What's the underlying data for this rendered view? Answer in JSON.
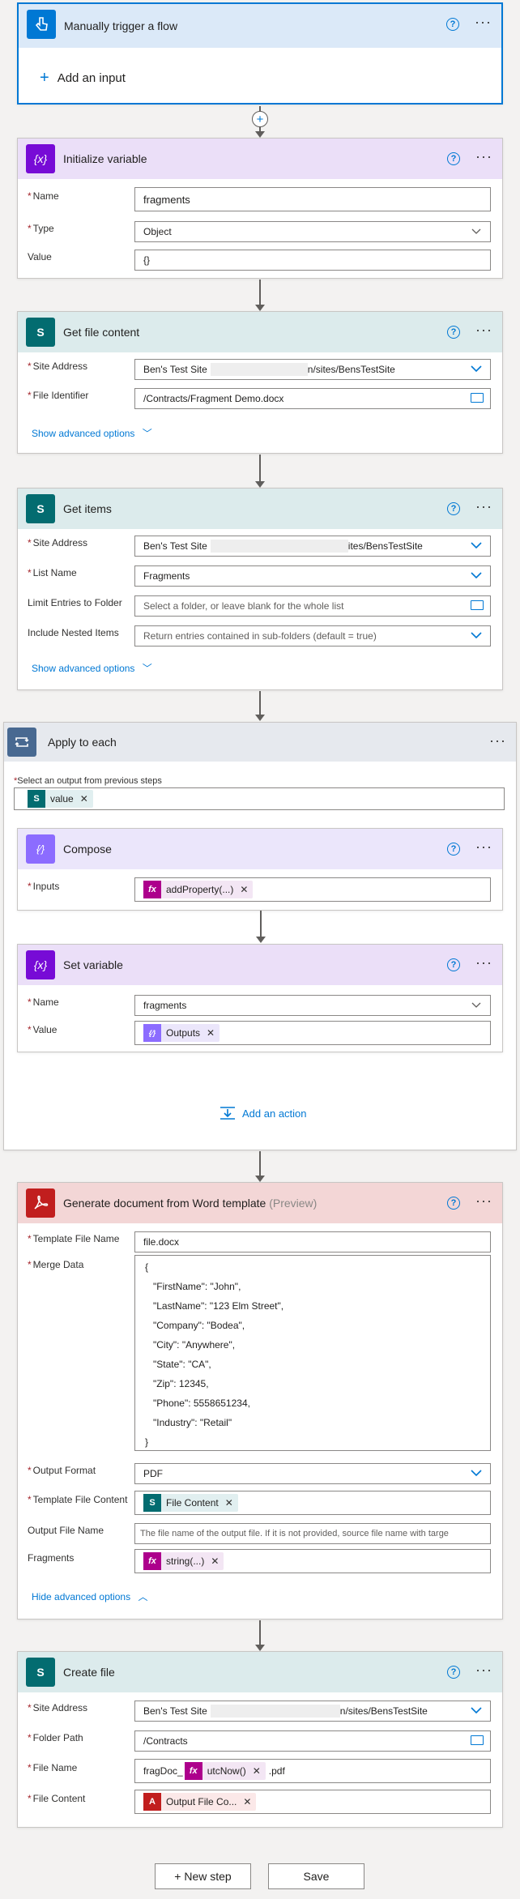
{
  "colors": {
    "accent": "#0078d4",
    "trigger_head": "#dbe9f8",
    "variable_head": "#ebdff8",
    "sharepoint_head": "#dcebec",
    "loop_head": "#e6e9ee",
    "word_head": "#f3d6d6",
    "variable_icon": "#770bd6",
    "compose_icon": "#8c6cff",
    "sharepoint_icon": "#036c70",
    "trigger_icon": "#0078d4",
    "loop_icon": "#486991",
    "word_icon": "#c11e1e",
    "fx_token": "#ad008c"
  },
  "trigger": {
    "title": "Manually trigger a flow",
    "add_input": "Add an input",
    "help": "?",
    "more": "···"
  },
  "init_var": {
    "title": "Initialize variable",
    "name_label": "Name",
    "name_value": "fragments",
    "type_label": "Type",
    "type_value": "Object",
    "value_label": "Value",
    "value_value": "{}"
  },
  "get_file": {
    "title": "Get file content",
    "site_label": "Site Address",
    "site_value_start": "Ben's Test Site",
    "site_value_end": "n/sites/BensTestSite",
    "file_label": "File Identifier",
    "file_value": "/Contracts/Fragment Demo.docx",
    "advanced": "Show advanced options"
  },
  "get_items": {
    "title": "Get items",
    "site_label": "Site Address",
    "site_value_start": "Ben's Test Site",
    "site_value_end": "ites/BensTestSite",
    "list_label": "List Name",
    "list_value": "Fragments",
    "folder_label": "Limit Entries to Folder",
    "folder_placeholder": "Select a folder, or leave blank for the whole list",
    "nested_label": "Include Nested Items",
    "nested_value": "Return entries contained in sub-folders (default = true)",
    "advanced": "Show advanced options"
  },
  "apply": {
    "title": "Apply to each",
    "select_label": "Select an output from previous steps",
    "token": "value",
    "add_action": "Add an action"
  },
  "compose": {
    "title": "Compose",
    "inputs_label": "Inputs",
    "token": "addProperty(...)"
  },
  "set_var": {
    "title": "Set variable",
    "name_label": "Name",
    "name_value": "fragments",
    "value_label": "Value",
    "token": "Outputs"
  },
  "word": {
    "title": "Generate document from Word template",
    "title_suffix": "(Preview)",
    "template_name_label": "Template File Name",
    "template_name_value": "file.docx",
    "merge_label": "Merge Data",
    "merge_lines": [
      "{",
      "\"FirstName\": \"John\",",
      "\"LastName\": \"123 Elm Street\",",
      "\"Company\": \"Bodea\",",
      "\"City\": \"Anywhere\",",
      "\"State\": \"CA\",",
      "\"Zip\": 12345,",
      "\"Phone\": 5558651234,",
      "\"Industry\": \"Retail\"",
      "}"
    ],
    "format_label": "Output Format",
    "format_value": "PDF",
    "content_label": "Template File Content",
    "content_token": "File Content",
    "output_name_label": "Output File Name",
    "output_name_placeholder": "The file name of the output file. If it is not provided, source file name with targe",
    "fragments_label": "Fragments",
    "fragments_token": "string(...)",
    "hide_advanced": "Hide advanced options"
  },
  "create_file": {
    "title": "Create file",
    "site_label": "Site Address",
    "site_value_start": "Ben's Test Site",
    "site_value_end": "n/sites/BensTestSite",
    "folder_label": "Folder Path",
    "folder_value": "/Contracts",
    "name_label": "File Name",
    "name_prefix": "fragDoc_",
    "name_token": "utcNow()",
    "name_suffix": ".pdf",
    "content_label": "File Content",
    "content_token": "Output File Co..."
  },
  "footer": {
    "new_step": "+ New step",
    "save": "Save"
  }
}
